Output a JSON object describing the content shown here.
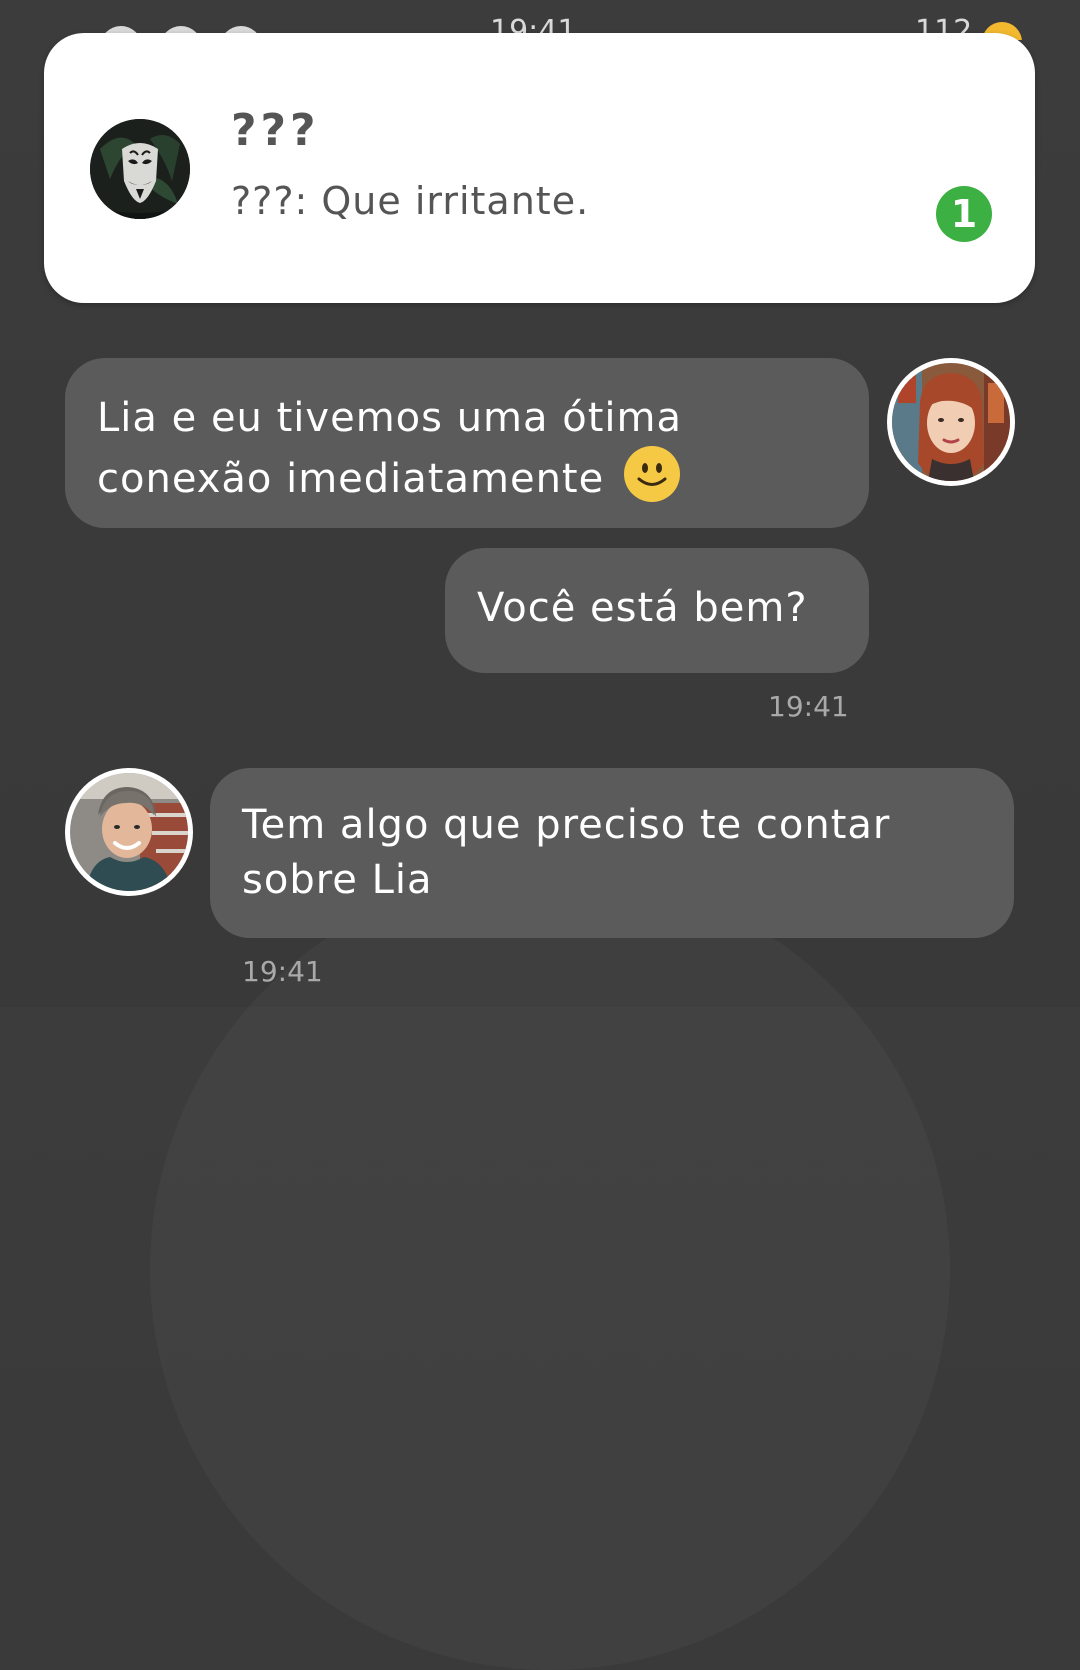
{
  "status_bar": {
    "time": "19:41",
    "battery": "112"
  },
  "notification": {
    "title": "???",
    "message": "???: Que irritante.",
    "badge_count": "1"
  },
  "messages": [
    {
      "text": "Lia e eu tivemos uma ótima conexão imediatamente",
      "line1": "Lia e eu tivemos uma ótima",
      "line2": "conexão imediatamente",
      "emoji": "smiley-icon"
    },
    {
      "text": "Você está bem?",
      "timestamp": "19:41"
    },
    {
      "text": "Tem algo que preciso te contar sobre Lia",
      "line1": "Tem algo que preciso te contar",
      "line2": "sobre Lia",
      "timestamp": "19:41"
    }
  ],
  "colors": {
    "background": "#3c3c3c",
    "bubble": "#5b5b5b",
    "badge": "#3cb043",
    "notification_text": "#555555",
    "timestamp": "#a9a9a9"
  }
}
